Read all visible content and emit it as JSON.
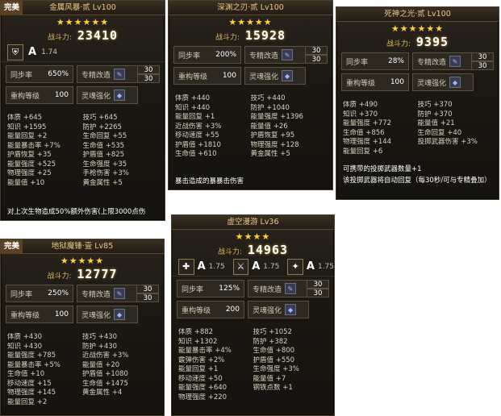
{
  "cards": [
    {
      "title": "金属风暴·贰 Lv100",
      "quality": "完美",
      "stars": "★★★★★★",
      "power_label": "战斗力:",
      "power": "23410",
      "resonance": [
        {
          "icon": "shield-icon",
          "grade": "A",
          "value": "1.74"
        }
      ],
      "sync_label": "同步率",
      "sync_value": "650%",
      "rebuild_label": "重构等级",
      "rebuild_value": "100",
      "mod_label": "专精改造",
      "mod_nums": [
        "30",
        "30"
      ],
      "soul_label": "灵魂强化",
      "stats": [
        "体质 +645",
        "技巧 +645",
        "知识 +1595",
        "防护 +2265",
        "能量回复 +2",
        "生命回复 +55",
        "能量暴击率 +7%",
        "生命值 +535",
        "护盾恢复 +35",
        "护盾值 +825",
        "能量强度 +525",
        "生命强度 +35",
        "物理强度 +25",
        "手枪伤害 +3%",
        "能量值 +10",
        "黄金属性 +5"
      ],
      "note": "对上次生物造成50%额外伤害(上限3000点伤"
    },
    {
      "title": "深渊之刃·贰 Lv100",
      "stars": "★★★★★",
      "power_label": "战斗力:",
      "power": "15928",
      "sync_label": "同步率",
      "sync_value": "200%",
      "rebuild_label": "重构等级",
      "rebuild_value": "100",
      "mod_label": "专精改造",
      "mod_nums": [
        "30",
        "30"
      ],
      "soul_label": "灵魂强化",
      "stats": [
        "体质 +440",
        "技巧 +440",
        "知识 +440",
        "防护 +1040",
        "能量回复 +1",
        "能量强度 +1396",
        "近战伤害 +3%",
        "能量值 +26",
        "移动速度 +55",
        "护盾恢复 +95",
        "护盾值 +1810",
        "物理强度 +128",
        "生命值 +610",
        "黄金属性 +5"
      ],
      "note": "暴击造成的暴暴击伤害"
    },
    {
      "title": "死神之光·贰 Lv100",
      "stars": "★★★★★★",
      "power_label": "战斗力:",
      "power": "9395",
      "sync_label": "同步率",
      "sync_value": "28%",
      "rebuild_label": "重构等级",
      "rebuild_value": "100",
      "mod_label": "专精改造",
      "mod_nums": [
        "30",
        "30"
      ],
      "soul_label": "灵魂强化",
      "stats": [
        "体质 +490",
        "技巧 +370",
        "知识 +370",
        "防护 +370",
        "能量强度 +772",
        "能量值 +21",
        "生命值 +856",
        "生命回复 +40",
        "物理强度 +144",
        "投掷武器伤害 +3%",
        "能量回复 +6",
        ""
      ],
      "note1": "可携带的投掷武器数量+1",
      "note2": "该投掷武器将自动回复（每30秒/可与专精叠加）"
    },
    {
      "title": "地狱魔锤·壹 Lv85",
      "quality": "完美",
      "stars": "★★★★★",
      "power_label": "战斗力:",
      "power": "12777",
      "sync_label": "同步率",
      "sync_value": "250%",
      "rebuild_label": "重构等级",
      "rebuild_value": "100",
      "mod_label": "专精改造",
      "mod_nums": [
        "30",
        "30"
      ],
      "soul_label": "灵魂强化",
      "stats": [
        "体质 +430",
        "技巧 +430",
        "知识 +430",
        "防护 +430",
        "能量强度 +785",
        "近战伤害 +3%",
        "能量暴击率 +5%",
        "能量值 +20",
        "生命值 +10",
        "护盾值 +1080",
        "移动速度 +15",
        "生命值 +1475",
        "物理强度 +145",
        "黄金属性 +4",
        "能量回复 +2",
        ""
      ]
    },
    {
      "title": "虚空漫游 Lv36",
      "stars": "★★★★",
      "power_label": "战斗力:",
      "power": "14963",
      "resonance": [
        {
          "icon": "cross-icon",
          "grade": "A",
          "value": "1.75"
        },
        {
          "icon": "blade-icon",
          "grade": "A",
          "value": "1.75"
        },
        {
          "icon": "claw-icon",
          "grade": "A",
          "value": "1.75"
        }
      ],
      "sync_label": "同步率",
      "sync_value": "125%",
      "rebuild_label": "重构等级",
      "rebuild_value": "200",
      "mod_label": "专精改造",
      "mod_nums": [
        "30",
        "30"
      ],
      "soul_label": "灵魂强化",
      "stats": [
        "体质 +882",
        "技巧 +1052",
        "知识 +1302",
        "防护 +382",
        "能量暴击率 +4%",
        "生命值 +800",
        "霰弹伤害 +2%",
        "护盾值 +550",
        "能量回复 +1",
        "生命强度 +3%",
        "移动速度 +50",
        "能量值 +7",
        "能量强度 +640",
        "钢铁点数 +1",
        "物理强度 +220",
        ""
      ]
    }
  ]
}
